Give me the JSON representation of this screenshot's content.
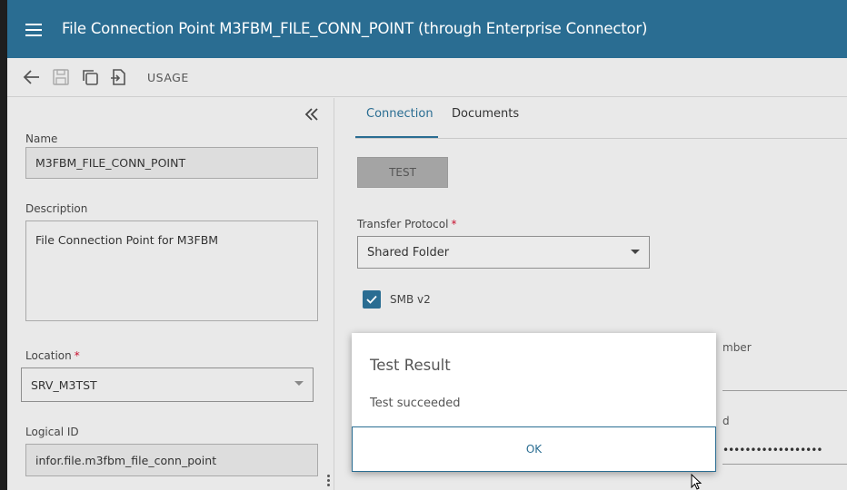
{
  "header": {
    "title": "File Connection Point M3FBM_FILE_CONN_POINT (through Enterprise Connector)",
    "color": "#2a6d92"
  },
  "toolbar": {
    "back_icon": "arrow-left-icon",
    "save_icon": "save-icon",
    "copy_icon": "copy-icon",
    "export_icon": "export-icon",
    "usage_label": "USAGE"
  },
  "left_panel": {
    "name_label": "Name",
    "name_value": "M3FBM_FILE_CONN_POINT",
    "description_label": "Description",
    "description_value": "File Connection Point for M3FBM",
    "location_label": "Location",
    "location_required": "*",
    "location_value": "SRV_M3TST",
    "logical_id_label": "Logical ID",
    "logical_id_value": "infor.file.m3fbm_file_conn_point"
  },
  "right_panel": {
    "tabs": [
      {
        "label": "Connection",
        "active": true
      },
      {
        "label": "Documents",
        "active": false
      }
    ],
    "test_button": "TEST",
    "transfer_protocol_label": "Transfer Protocol",
    "transfer_protocol_required": "*",
    "transfer_protocol_value": "Shared Folder",
    "smb_label": "SMB v2",
    "smb_checked": true,
    "partial_label_1": "mber",
    "partial_label_2": "d",
    "password_mask": "••••••••••••••••••••••••••••••••••"
  },
  "dialog": {
    "title": "Test Result",
    "message": "Test succeeded",
    "ok_label": "OK"
  },
  "colors": {
    "accent": "#2a6d92",
    "required": "#c8102e"
  }
}
